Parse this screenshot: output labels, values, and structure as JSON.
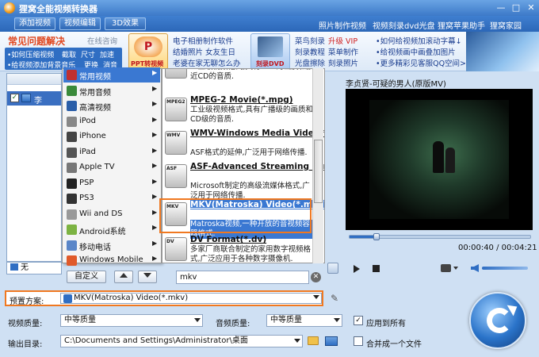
{
  "app": {
    "title": "狸窝全能视频转换器"
  },
  "toolbar": {
    "add_video": "添加视频",
    "edit_video": "视频编辑",
    "effect_3d": "3D效果",
    "links": [
      "照片制作视频",
      "视频刻录dvd光盘",
      "狸窝苹果助手",
      "狸窝家园"
    ]
  },
  "banner": {
    "faq_title": "常见问题解决",
    "faq_online": "在线咨询",
    "faq_row1": [
      "•如何压缩视频",
      "截取",
      "尺寸",
      "加速"
    ],
    "faq_row2": [
      "•给视频添加背景音乐",
      "更换",
      "消音"
    ],
    "ppt_label": "PPT转视频",
    "col2": [
      "电子相册制作软件",
      "结婚照片  女友生日",
      "老婆在家无聊怎么办"
    ],
    "dvd_label": "刻录DVD",
    "col4a": [
      "菜鸟刻录",
      "升级 VIP"
    ],
    "col4b": [
      "刻录教程",
      "菜单制作"
    ],
    "col4c": [
      "光盘擦除",
      "刻录照片"
    ],
    "col5": [
      "•如何给视频加滚动字幕↓",
      "•给视频画中画叠加图片",
      "•更多精彩见客服QQ空间>>"
    ]
  },
  "left": {
    "item": "李"
  },
  "categories": [
    {
      "label": "常用视频",
      "color": "#c03030"
    },
    {
      "label": "常用音频",
      "color": "#3a8a3a"
    },
    {
      "label": "高清视频",
      "color": "#2a5ea8"
    },
    {
      "label": "iPod",
      "color": "#888888"
    },
    {
      "label": "iPhone",
      "color": "#444444"
    },
    {
      "label": "iPad",
      "color": "#555555"
    },
    {
      "label": "Apple TV",
      "color": "#777777"
    },
    {
      "label": "PSP",
      "color": "#222222"
    },
    {
      "label": "PS3",
      "color": "#333333"
    },
    {
      "label": "Wii and DS",
      "color": "#999999"
    },
    {
      "label": "Android系统",
      "color": "#7cb342"
    },
    {
      "label": "移动电话",
      "color": "#5a86c8"
    },
    {
      "label": "Windows Mobile",
      "color": "#e05a2a"
    }
  ],
  "formats": [
    {
      "icon": "",
      "title": "",
      "desc": "工业级视频格式,具有VHS的画质和接近CD的音质."
    },
    {
      "icon": "MPEG2",
      "title": "MPEG-2 Movie(*.mpg)",
      "desc": "工业级视频格式,具有广播级的画质和CD级的音质."
    },
    {
      "icon": "WMV",
      "title": "WMV-Windows Media Video(*.wmv)",
      "desc": "ASF格式的延伸,广泛用于网络传播."
    },
    {
      "icon": "ASF",
      "title": "ASF-Advanced Streaming Format(*.asf)",
      "desc": "Microsoft制定的高级流媒体格式,广泛用于网络传播."
    },
    {
      "icon": "MKV",
      "title": "MKV(Matroska) Video(*.mkv)",
      "desc": "Matroska视频,一种开放的音视频容器格式."
    },
    {
      "icon": "DV",
      "title": "DV Format(*.dv)",
      "desc": "多家厂商联合制定的家用数字视频格式,广泛应用于各种数字摄像机."
    }
  ],
  "controls": {
    "custom": "自定义",
    "search_value": "mkv",
    "none": "无"
  },
  "preview": {
    "title": "李贞贤-可疑的男人(原版MV)",
    "time": "00:00:40 / 00:04:21",
    "progress": 0.15
  },
  "settings": {
    "preset_label": "预置方案:",
    "preset_value": "MKV(Matroska) Video(*.mkv)",
    "video_quality_label": "视频质量:",
    "video_quality_value": "中等质量",
    "audio_quality_label": "音频质量:",
    "audio_quality_value": "中等质量",
    "apply_all": "应用到所有",
    "output_label": "输出目录:",
    "output_path": "C:\\Documents and Settings\\Administrator\\桌面",
    "merge_label": "合并成一个文件"
  }
}
